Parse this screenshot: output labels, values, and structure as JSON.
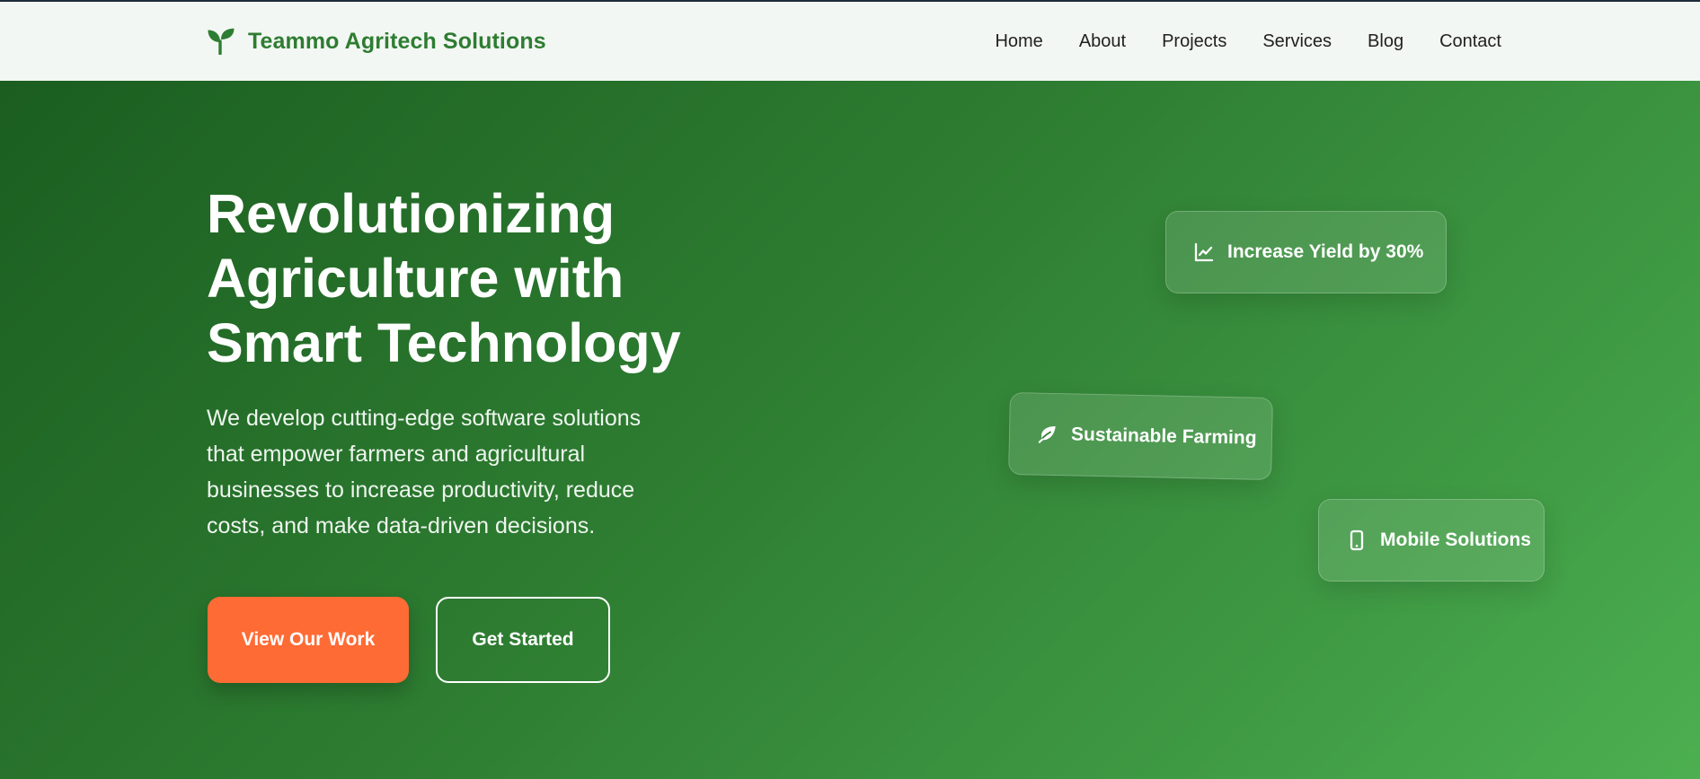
{
  "brand": {
    "icon": "seedling-icon",
    "name": "Teammo Agritech Solutions",
    "color": "#2e7d32"
  },
  "nav": {
    "items": [
      {
        "label": "Home"
      },
      {
        "label": "About"
      },
      {
        "label": "Projects"
      },
      {
        "label": "Services"
      },
      {
        "label": "Blog"
      },
      {
        "label": "Contact"
      }
    ]
  },
  "hero": {
    "title_lines": [
      "Revolutionizing",
      "Agriculture with",
      "Smart Technology"
    ],
    "description_lines": [
      "We develop cutting-edge software solutions",
      "that empower farmers and agricultural",
      "businesses to increase productivity, reduce",
      "costs, and make data-driven decisions."
    ],
    "primary_button": "View Our Work",
    "secondary_button": "Get Started",
    "accent_color": "#ff6b35",
    "gradient_colors": [
      "#1b5e20",
      "#4caf50"
    ]
  },
  "feature_cards": [
    {
      "icon": "chart-line-icon",
      "label": "Increase Yield by 30%"
    },
    {
      "icon": "leaf-icon",
      "label": "Sustainable Farming"
    },
    {
      "icon": "mobile-phone-icon",
      "label": "Mobile Solutions"
    }
  ]
}
